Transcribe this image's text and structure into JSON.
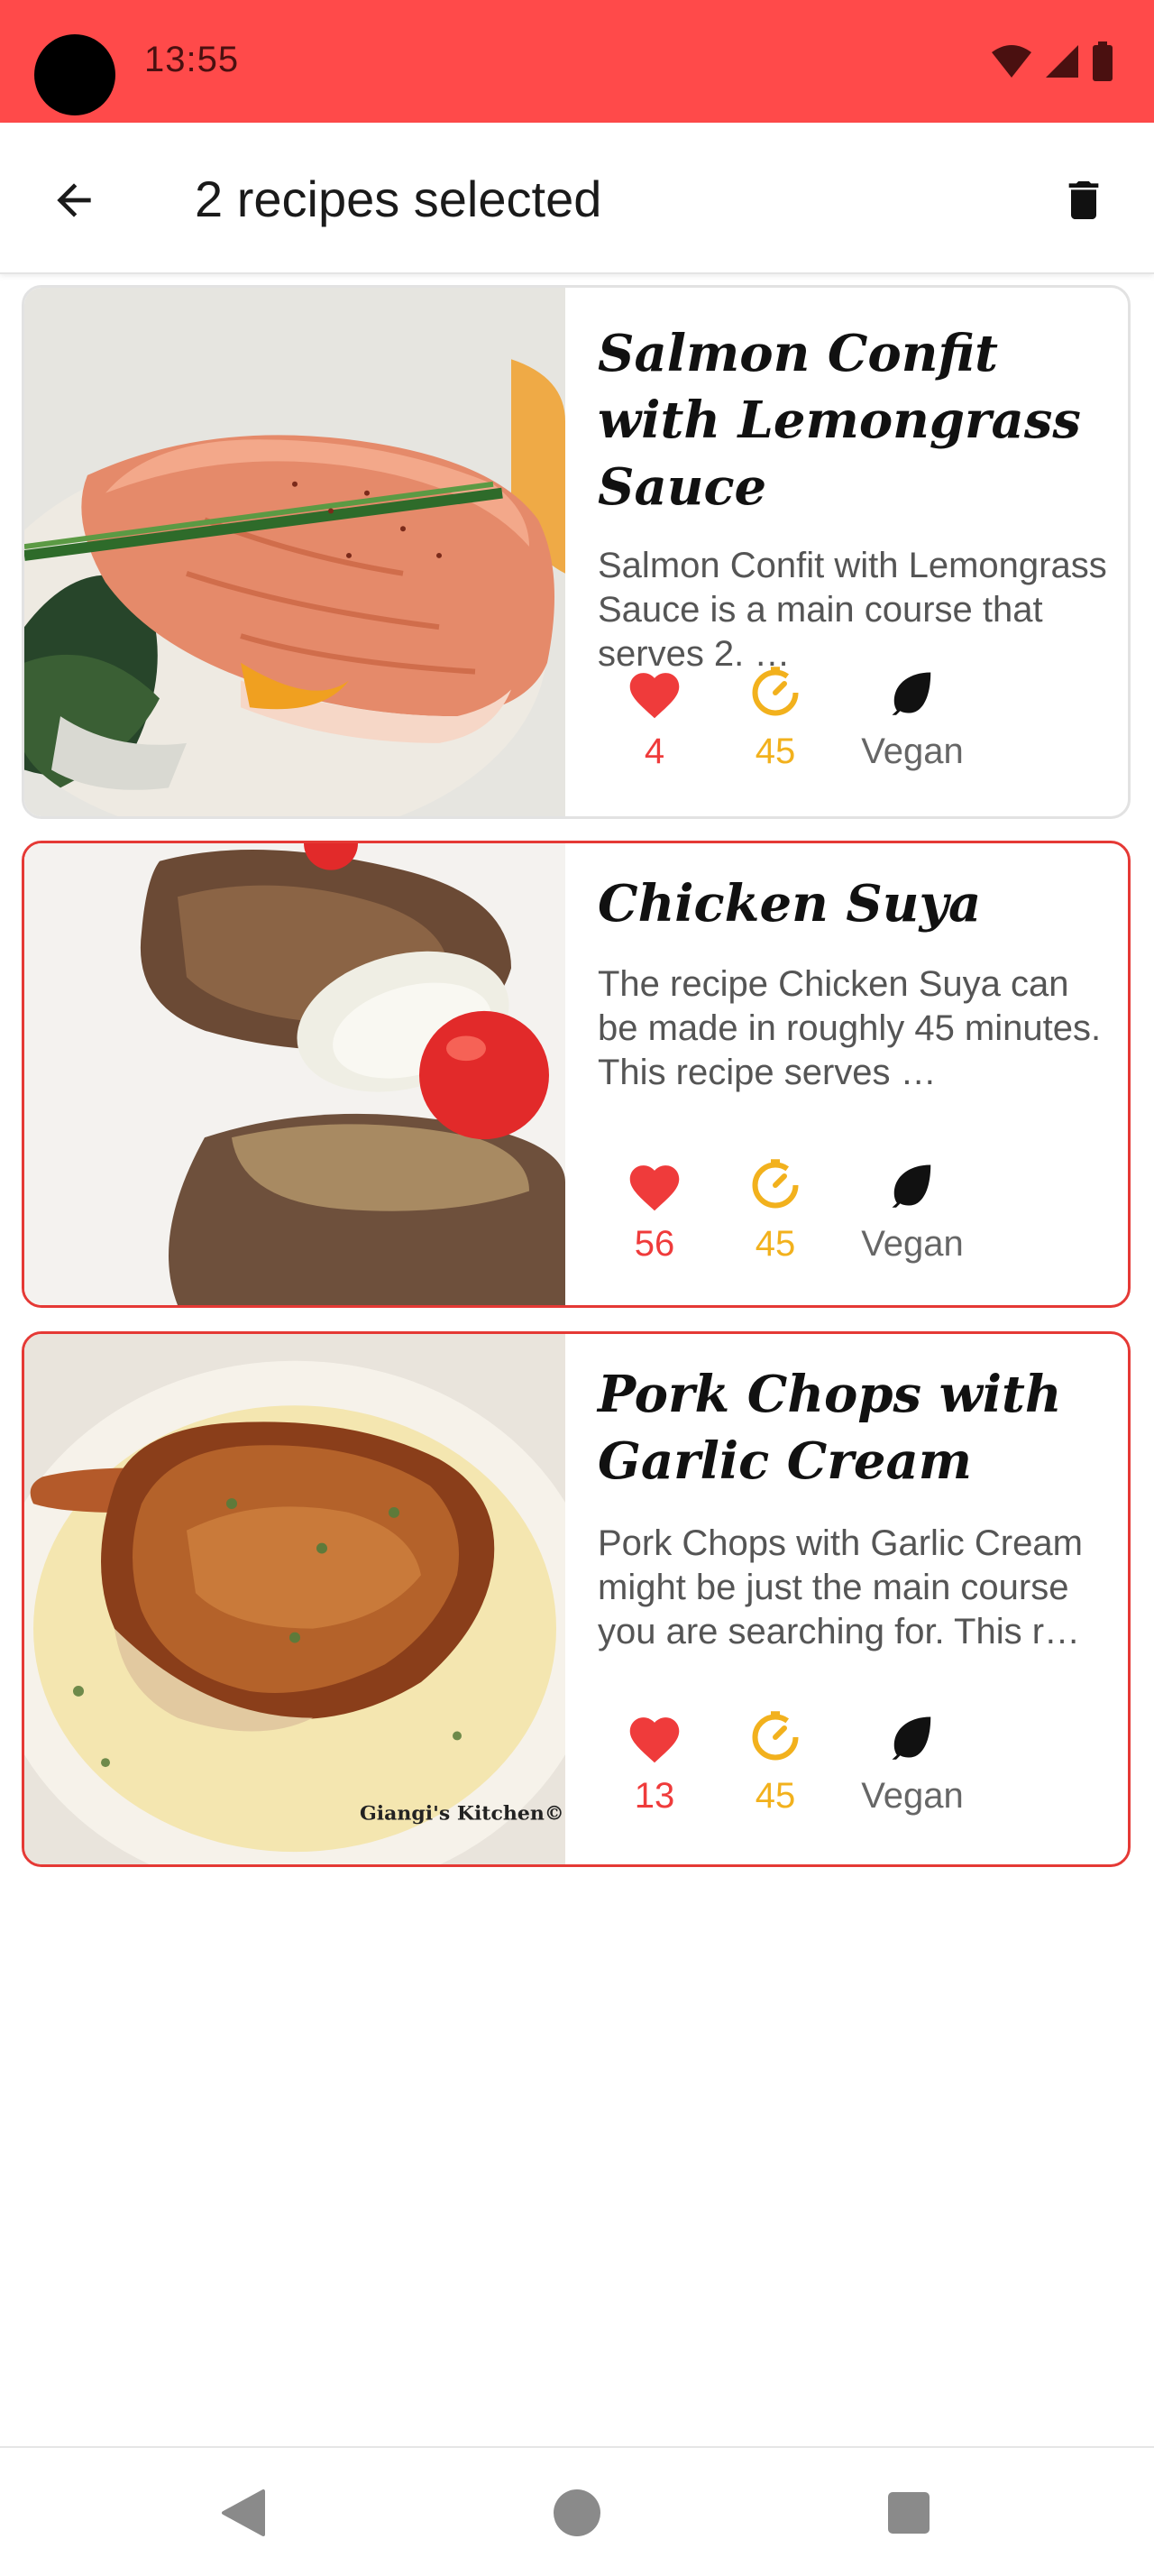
{
  "status_bar": {
    "time": "13:55"
  },
  "app_bar": {
    "title": "2 recipes selected"
  },
  "recipes": [
    {
      "title": "Salmon Confit with Lemongrass Sauce",
      "description": "Salmon Confit with Lemongrass Sauce is a main course that serves 2. …",
      "likes": "4",
      "minutes": "45",
      "diet_label": "Vegan",
      "selected": false
    },
    {
      "title": "Chicken Suya",
      "description": "The recipe Chicken Suya can be made in roughly 45 minutes. This recipe serves …",
      "likes": "56",
      "minutes": "45",
      "diet_label": "Vegan",
      "selected": true
    },
    {
      "title": "Pork Chops with Garlic Cream",
      "description": "Pork Chops with Garlic Cream might be just the main course you are searching for. This r…",
      "likes": "13",
      "minutes": "45",
      "diet_label": "Vegan",
      "selected": true
    }
  ],
  "image_watermark": "Giangi's Kitchen©",
  "colors": {
    "status_bar": "#ff4a4a",
    "selected_border": "#e53935",
    "heart": "#ef3b3b",
    "clock": "#f2b11d",
    "leaf": "#111111"
  },
  "icons": {
    "back": "arrow-left-icon",
    "delete": "trash-icon",
    "likes": "heart-icon",
    "time": "clock-icon",
    "diet": "leaf-icon",
    "nav_back": "triangle-back-icon",
    "nav_home": "circle-home-icon",
    "nav_recents": "square-recents-icon"
  }
}
